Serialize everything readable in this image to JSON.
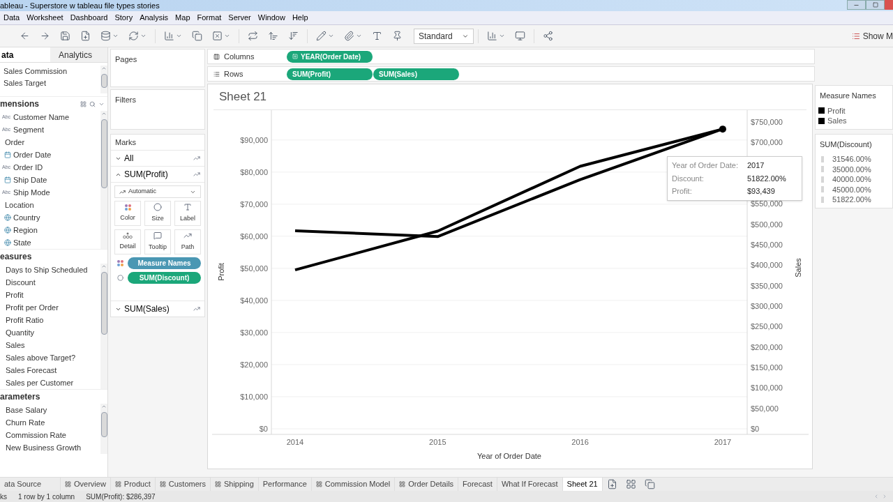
{
  "window": {
    "title": "ableau - Superstore w tableau file types stories"
  },
  "menu": [
    "Data",
    "Worksheet",
    "Dashboard",
    "Story",
    "Analysis",
    "Map",
    "Format",
    "Server",
    "Window",
    "Help"
  ],
  "toolbar": {
    "fit": "Standard",
    "show_me": "Show M"
  },
  "data_pane": {
    "tabs": [
      {
        "label": "ata",
        "selected": true
      },
      {
        "label": "Analytics",
        "selected": false
      }
    ],
    "sources": [
      "Sales Commission",
      "Sales Target"
    ],
    "sections": [
      {
        "title": "mensions",
        "items": [
          {
            "label": "Customer Name",
            "kind": "string",
            "type_label": "Abc"
          },
          {
            "label": "Segment",
            "kind": "string",
            "type_label": "Abc"
          },
          {
            "label": "Order",
            "kind": "folder"
          },
          {
            "label": "Order Date",
            "kind": "date"
          },
          {
            "label": "Order ID",
            "kind": "string",
            "type_label": "Abc"
          },
          {
            "label": "Ship Date",
            "kind": "date"
          },
          {
            "label": "Ship Mode",
            "kind": "string",
            "type_label": "Abc"
          },
          {
            "label": "Location",
            "kind": "folder"
          },
          {
            "label": "Country",
            "kind": "geo"
          },
          {
            "label": "Region",
            "kind": "geo"
          },
          {
            "label": "State",
            "kind": "geo"
          }
        ]
      },
      {
        "title": "easures",
        "items": [
          {
            "label": "Days to Ship Scheduled",
            "kind": "measure"
          },
          {
            "label": "Discount",
            "kind": "measure"
          },
          {
            "label": "Profit",
            "kind": "measure"
          },
          {
            "label": "Profit per Order",
            "kind": "measure"
          },
          {
            "label": "Profit Ratio",
            "kind": "measure"
          },
          {
            "label": "Quantity",
            "kind": "measure"
          },
          {
            "label": "Sales",
            "kind": "measure"
          },
          {
            "label": "Sales above Target?",
            "kind": "measure"
          },
          {
            "label": "Sales Forecast",
            "kind": "measure"
          },
          {
            "label": "Sales per Customer",
            "kind": "measure"
          }
        ]
      },
      {
        "title": "arameters",
        "items": [
          {
            "label": "Base Salary",
            "kind": "measure"
          },
          {
            "label": "Churn Rate",
            "kind": "measure"
          },
          {
            "label": "Commission Rate",
            "kind": "measure"
          },
          {
            "label": "New Business Growth",
            "kind": "measure"
          }
        ]
      }
    ]
  },
  "cards": {
    "pages": "Pages",
    "filters": "Filters",
    "marks": {
      "title": "Marks",
      "mark_type": "Automatic",
      "layers": [
        {
          "label": "All",
          "expanded": false
        },
        {
          "label": "SUM(Profit)",
          "expanded": true
        },
        {
          "label": "SUM(Sales)",
          "expanded": false
        }
      ],
      "buttons": [
        {
          "label": "Color",
          "kind": "color"
        },
        {
          "label": "Size",
          "kind": "size"
        },
        {
          "label": "Label",
          "kind": "label"
        },
        {
          "label": "Detail",
          "kind": "detail"
        },
        {
          "label": "Tooltip",
          "kind": "tooltip"
        },
        {
          "label": "Path",
          "kind": "path"
        }
      ],
      "pills": [
        {
          "label": "Measure Names",
          "kind": "color",
          "color": "#4a97b3"
        },
        {
          "label": "SUM(Discount)",
          "kind": "size",
          "color": "#1ba77a"
        }
      ]
    }
  },
  "shelves": [
    {
      "label": "Columns",
      "kind": "columns",
      "pills": [
        {
          "label": "YEAR(Order Date)",
          "expandable": true
        }
      ]
    },
    {
      "label": "Rows",
      "kind": "rows",
      "pills": [
        {
          "label": "SUM(Profit)",
          "expandable": false
        },
        {
          "label": "SUM(Sales)",
          "expandable": false
        }
      ]
    }
  ],
  "view": {
    "title": "Sheet 21",
    "chart_data": {
      "type": "line",
      "grid": true,
      "xlabel": "Year of Order Date",
      "ylabel": "Profit",
      "categories": [
        "2014",
        "2015",
        "2016",
        "2017"
      ],
      "series": [
        {
          "color": "#000000",
          "values": [
            49500,
            61600,
            81800,
            93400
          ]
        }
      ],
      "ylim": [
        0,
        99300
      ],
      "yticks": [
        {
          "value": 0,
          "label": "$0"
        },
        {
          "value": 10000,
          "label": "$10,000"
        },
        {
          "value": 20000,
          "label": "$20,000"
        },
        {
          "value": 30000,
          "label": "$30,000"
        },
        {
          "value": 40000,
          "label": "$40,000"
        },
        {
          "value": 50000,
          "label": "$50,000"
        },
        {
          "value": 60000,
          "label": "$60,000"
        },
        {
          "value": 70000,
          "label": "$70,000"
        },
        {
          "value": 80000,
          "label": "$80,000"
        },
        {
          "value": 90000,
          "label": "$90,000"
        }
      ]
    },
    "sales_chart": {
      "chart_data": {
        "type": "line",
        "ylabel": "Sales",
        "series": [
          {
            "color": "#000000",
            "values": [
              484000,
              470000,
              609000,
              733000
            ]
          }
        ],
        "ylim": [
          0,
          779000
        ],
        "yticks": [
          {
            "value": 0,
            "label": "$0"
          },
          {
            "value": 50000,
            "label": "$50,000"
          },
          {
            "value": 100000,
            "label": "$100,000"
          },
          {
            "value": 150000,
            "label": "$150,000"
          },
          {
            "value": 200000,
            "label": "$200,000"
          },
          {
            "value": 250000,
            "label": "$250,000"
          },
          {
            "value": 300000,
            "label": "$300,000"
          },
          {
            "value": 350000,
            "label": "$350,000"
          },
          {
            "value": 400000,
            "label": "$400,000"
          },
          {
            "value": 450000,
            "label": "$450,000"
          },
          {
            "value": 500000,
            "label": "$500,000"
          },
          {
            "value": 550000,
            "label": "$550,000"
          },
          {
            "value": 700000,
            "label": "$700,000"
          },
          {
            "value": 750000,
            "label": "$750,000"
          }
        ]
      }
    },
    "tooltip": [
      {
        "label": "Year of Order Date:",
        "value": "2017"
      },
      {
        "label": "Discount:",
        "value": "51822.00%"
      },
      {
        "label": "Profit:",
        "value": "$93,439"
      }
    ]
  },
  "legends": [
    {
      "title": "Measure Names",
      "kind": "color",
      "items": [
        {
          "label": "Profit",
          "color": "#000000"
        },
        {
          "label": "Sales",
          "color": "#000000"
        }
      ]
    },
    {
      "title": "SUM(Discount)",
      "kind": "size",
      "items": [
        {
          "label": "31546.00%"
        },
        {
          "label": "35000.00%"
        },
        {
          "label": "40000.00%"
        },
        {
          "label": "45000.00%"
        },
        {
          "label": "51822.00%"
        }
      ]
    }
  ],
  "sheet_tabs": [
    {
      "label": "ata Source",
      "kind": "source",
      "selected": false
    },
    {
      "label": "Overview",
      "kind": "dashboard",
      "selected": false
    },
    {
      "label": "Product",
      "kind": "dashboard",
      "selected": false
    },
    {
      "label": "Customers",
      "kind": "dashboard",
      "selected": false
    },
    {
      "label": "Shipping",
      "kind": "dashboard",
      "selected": false
    },
    {
      "label": "Performance",
      "kind": "story",
      "selected": false
    },
    {
      "label": "Commission Model",
      "kind": "dashboard",
      "selected": false
    },
    {
      "label": "Order Details",
      "kind": "dashboard",
      "selected": false
    },
    {
      "label": "Forecast",
      "kind": "sheet",
      "selected": false
    },
    {
      "label": "What If Forecast",
      "kind": "sheet",
      "selected": false
    },
    {
      "label": "Sheet 21",
      "kind": "sheet",
      "selected": true
    }
  ],
  "status_bar": [
    "ks",
    "1 row by 1 column",
    "SUM(Profit): $286,397"
  ]
}
